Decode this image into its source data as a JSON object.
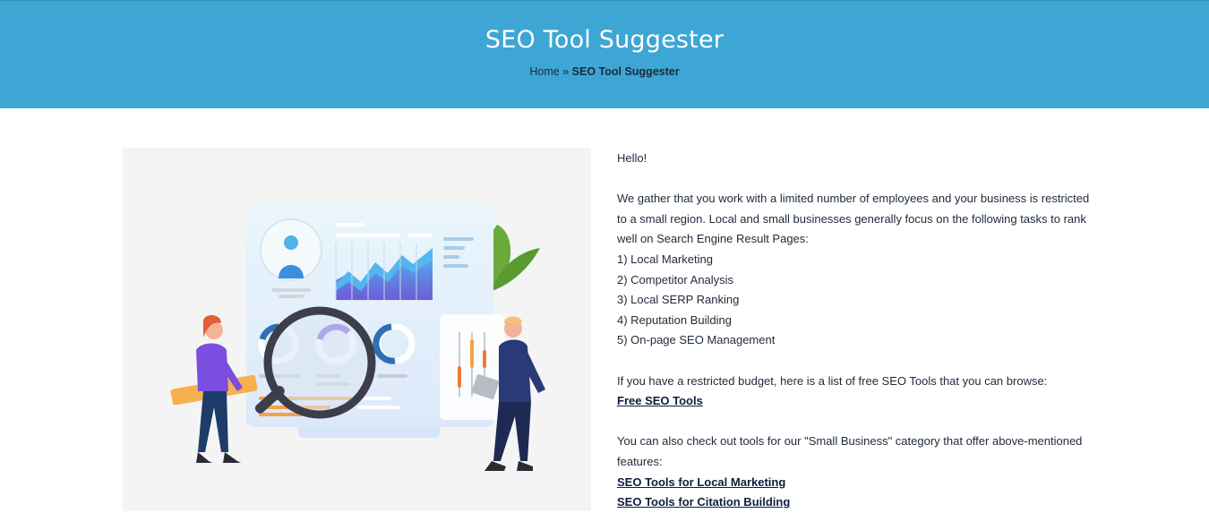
{
  "header": {
    "title": "SEO Tool Suggester",
    "breadcrumb": {
      "home": "Home",
      "separator": " » ",
      "current": "SEO Tool Suggester"
    }
  },
  "colors": {
    "hero_bg": "#3da6d4",
    "text": "#1e2a3a",
    "link": "#0f1e3d"
  },
  "illustration": {
    "icon": "seo-analytics-illustration"
  },
  "content": {
    "greeting": "Hello!",
    "intro": "We gather that you work with a limited number of employees and your business is restricted to a small region. Local and small businesses generally focus on the following tasks to rank well on Search Engine Result Pages:",
    "tasks": [
      "1) Local Marketing",
      "2) Competitor Analysis",
      "3) Local SERP Ranking",
      "4) Reputation Building",
      "5) On-page SEO Management"
    ],
    "budget_text": "If you have a restricted budget, here is a list of free SEO Tools that you can browse:",
    "free_tools_link": "Free SEO Tools",
    "category_text": "You can also check out tools for our \"Small Business\" category  that offer above-mentioned features:",
    "links": [
      "SEO Tools for Local Marketing",
      "SEO Tools for Citation Building"
    ]
  }
}
